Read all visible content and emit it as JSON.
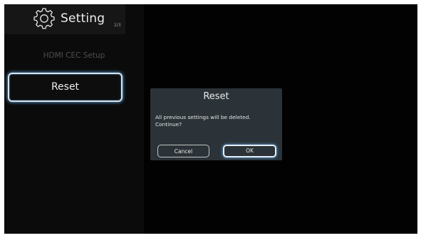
{
  "header": {
    "title": "Setting",
    "page_indicator": "2/3",
    "icon": "gear-icon"
  },
  "menu": {
    "hdmi_cec_label": "HDMI CEC Setup",
    "reset_label": "Reset"
  },
  "dialog": {
    "title": "Reset",
    "message_line1": "All previous settings will be deleted.",
    "message_line2": "Continue?",
    "cancel_label": "Cancel",
    "ok_label": "OK"
  },
  "colors": {
    "background": "#020202",
    "sidebar": "#0b0b0b",
    "dialog": "#2b3338",
    "focus_glow": "#4d82b0"
  }
}
